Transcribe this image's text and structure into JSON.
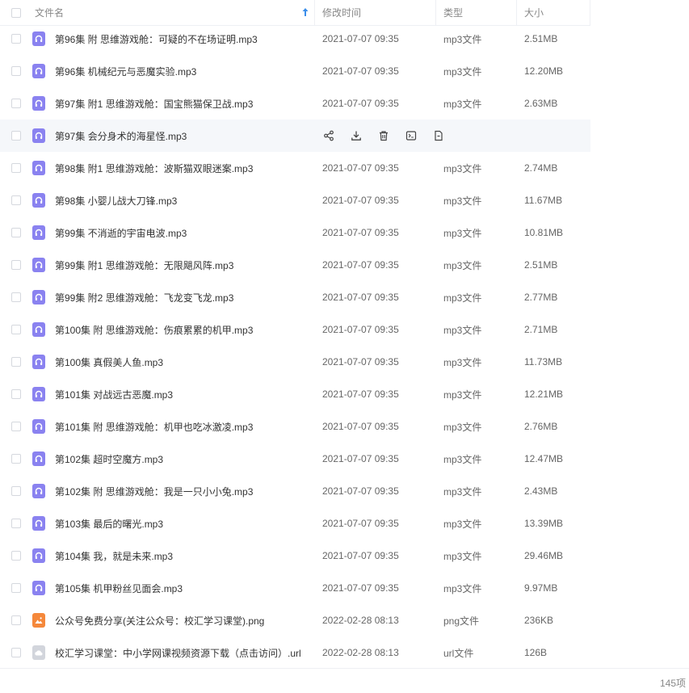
{
  "header": {
    "name_label": "文件名",
    "time_label": "修改时间",
    "type_label": "类型",
    "size_label": "大小"
  },
  "accent_color": "#3b8eea",
  "hover_row_index": 3,
  "rows": [
    {
      "name": "第96集 附 思维游戏舱：可疑的不在场证明.mp3",
      "time": "2021-07-07 09:35",
      "type": "mp3文件",
      "size": "2.51MB",
      "icon": "audio-file-icon"
    },
    {
      "name": "第96集 机械纪元与恶魔实验.mp3",
      "time": "2021-07-07 09:35",
      "type": "mp3文件",
      "size": "12.20MB",
      "icon": "audio-file-icon"
    },
    {
      "name": "第97集 附1 思维游戏舱：国宝熊猫保卫战.mp3",
      "time": "2021-07-07 09:35",
      "type": "mp3文件",
      "size": "2.63MB",
      "icon": "audio-file-icon"
    },
    {
      "name": "第97集 会分身术的海星怪.mp3",
      "time": "",
      "type": "",
      "size": "",
      "icon": "audio-file-icon"
    },
    {
      "name": "第98集 附1 思维游戏舱：波斯猫双眼迷案.mp3",
      "time": "2021-07-07 09:35",
      "type": "mp3文件",
      "size": "2.74MB",
      "icon": "audio-file-icon"
    },
    {
      "name": "第98集 小婴儿战大刀锋.mp3",
      "time": "2021-07-07 09:35",
      "type": "mp3文件",
      "size": "11.67MB",
      "icon": "audio-file-icon"
    },
    {
      "name": "第99集 不消逝的宇宙电波.mp3",
      "time": "2021-07-07 09:35",
      "type": "mp3文件",
      "size": "10.81MB",
      "icon": "audio-file-icon"
    },
    {
      "name": "第99集 附1 思维游戏舱：无限飓风阵.mp3",
      "time": "2021-07-07 09:35",
      "type": "mp3文件",
      "size": "2.51MB",
      "icon": "audio-file-icon"
    },
    {
      "name": "第99集 附2 思维游戏舱：飞龙变飞龙.mp3",
      "time": "2021-07-07 09:35",
      "type": "mp3文件",
      "size": "2.77MB",
      "icon": "audio-file-icon"
    },
    {
      "name": "第100集 附 思维游戏舱：伤痕累累的机甲.mp3",
      "time": "2021-07-07 09:35",
      "type": "mp3文件",
      "size": "2.71MB",
      "icon": "audio-file-icon"
    },
    {
      "name": "第100集 真假美人鱼.mp3",
      "time": "2021-07-07 09:35",
      "type": "mp3文件",
      "size": "11.73MB",
      "icon": "audio-file-icon"
    },
    {
      "name": "第101集 对战远古恶魔.mp3",
      "time": "2021-07-07 09:35",
      "type": "mp3文件",
      "size": "12.21MB",
      "icon": "audio-file-icon"
    },
    {
      "name": "第101集 附 思维游戏舱：机甲也吃冰激凌.mp3",
      "time": "2021-07-07 09:35",
      "type": "mp3文件",
      "size": "2.76MB",
      "icon": "audio-file-icon"
    },
    {
      "name": "第102集 超时空魔方.mp3",
      "time": "2021-07-07 09:35",
      "type": "mp3文件",
      "size": "12.47MB",
      "icon": "audio-file-icon"
    },
    {
      "name": "第102集 附 思维游戏舱：我是一只小小兔.mp3",
      "time": "2021-07-07 09:35",
      "type": "mp3文件",
      "size": "2.43MB",
      "icon": "audio-file-icon"
    },
    {
      "name": "第103集 最后的曙光.mp3",
      "time": "2021-07-07 09:35",
      "type": "mp3文件",
      "size": "13.39MB",
      "icon": "audio-file-icon"
    },
    {
      "name": "第104集 我，就是未来.mp3",
      "time": "2021-07-07 09:35",
      "type": "mp3文件",
      "size": "29.46MB",
      "icon": "audio-file-icon"
    },
    {
      "name": "第105集 机甲粉丝见面会.mp3",
      "time": "2021-07-07 09:35",
      "type": "mp3文件",
      "size": "9.97MB",
      "icon": "audio-file-icon"
    },
    {
      "name": "公众号免费分享(关注公众号：校汇学习课堂).png",
      "time": "2022-02-28 08:13",
      "type": "png文件",
      "size": "236KB",
      "icon": "image-file-icon"
    },
    {
      "name": "校汇学习课堂：中小学网课视频资源下载（点击访问）.url",
      "time": "2022-02-28 08:13",
      "type": "url文件",
      "size": "126B",
      "icon": "link-file-icon"
    }
  ],
  "hover_actions": [
    "share-icon",
    "download-icon",
    "delete-icon",
    "rename-icon",
    "more-icon"
  ],
  "footer": {
    "count": "145项"
  }
}
